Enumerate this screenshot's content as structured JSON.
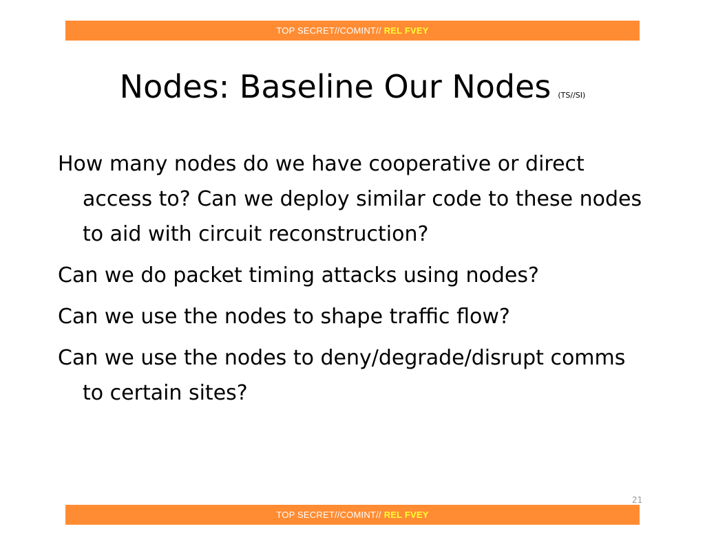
{
  "banner": {
    "classification": "TOP SECRET//COMINT//",
    "release": "REL FVEY"
  },
  "slide": {
    "title": "Nodes: Baseline Our Nodes",
    "title_marking": "(TS//SI)",
    "bullets": [
      "How many nodes do we have cooperative or direct access to? Can we deploy similar code to these nodes to aid with circuit reconstruction?",
      "Can we do packet timing attacks using nodes?",
      "Can we use the nodes to shape traffic flow?",
      "Can we use the nodes to deny/degrade/disrupt comms to certain sites?"
    ],
    "page_number": "21"
  },
  "colors": {
    "banner_bg": "#ff8c33",
    "banner_text": "#ffffff",
    "release_text": "#ffff33"
  }
}
